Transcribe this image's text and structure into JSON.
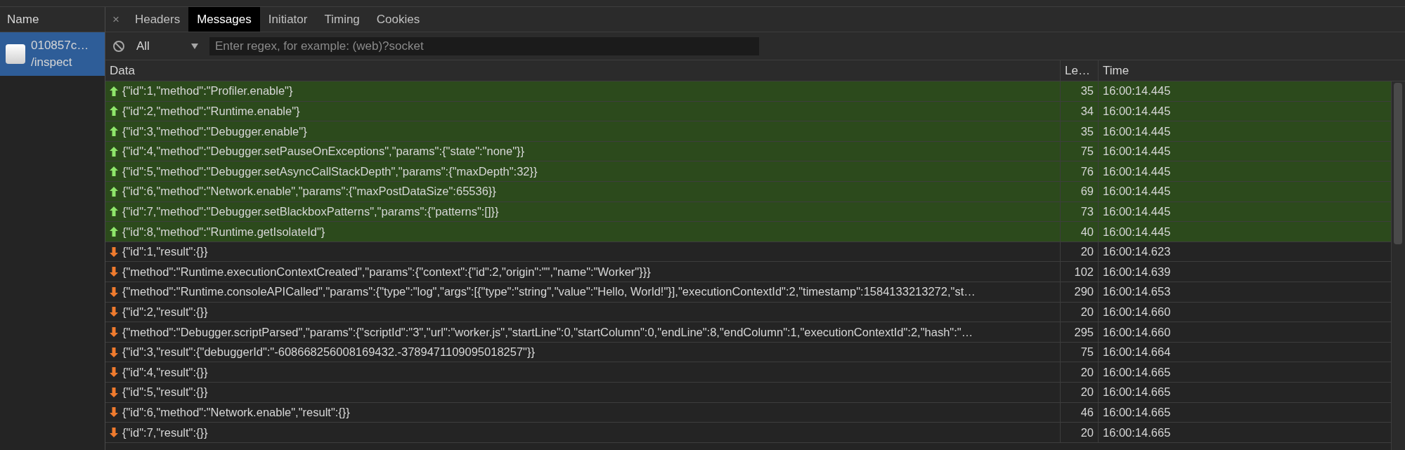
{
  "sidebar": {
    "header": "Name",
    "items": [
      {
        "name": "010857c…",
        "path": "/inspect",
        "selected": true
      }
    ]
  },
  "tabs_bar": {
    "close": "×",
    "tabs": [
      {
        "label": "Headers",
        "selected": false
      },
      {
        "label": "Messages",
        "selected": true
      },
      {
        "label": "Initiator",
        "selected": false
      },
      {
        "label": "Timing",
        "selected": false
      },
      {
        "label": "Cookies",
        "selected": false
      }
    ]
  },
  "filter": {
    "dropdown": "All",
    "placeholder": "Enter regex, for example: (web)?socket"
  },
  "table": {
    "columns": [
      "Data",
      "Le…",
      "Time"
    ],
    "rows": [
      {
        "kind": "sent",
        "data": "{\"id\":1,\"method\":\"Profiler.enable\"}",
        "length": "35",
        "time": "16:00:14.445"
      },
      {
        "kind": "sent",
        "data": "{\"id\":2,\"method\":\"Runtime.enable\"}",
        "length": "34",
        "time": "16:00:14.445"
      },
      {
        "kind": "sent",
        "data": "{\"id\":3,\"method\":\"Debugger.enable\"}",
        "length": "35",
        "time": "16:00:14.445"
      },
      {
        "kind": "sent",
        "data": "{\"id\":4,\"method\":\"Debugger.setPauseOnExceptions\",\"params\":{\"state\":\"none\"}}",
        "length": "75",
        "time": "16:00:14.445"
      },
      {
        "kind": "sent",
        "data": "{\"id\":5,\"method\":\"Debugger.setAsyncCallStackDepth\",\"params\":{\"maxDepth\":32}}",
        "length": "76",
        "time": "16:00:14.445"
      },
      {
        "kind": "sent",
        "data": "{\"id\":6,\"method\":\"Network.enable\",\"params\":{\"maxPostDataSize\":65536}}",
        "length": "69",
        "time": "16:00:14.445"
      },
      {
        "kind": "sent",
        "data": "{\"id\":7,\"method\":\"Debugger.setBlackboxPatterns\",\"params\":{\"patterns\":[]}}",
        "length": "73",
        "time": "16:00:14.445"
      },
      {
        "kind": "sent",
        "data": "{\"id\":8,\"method\":\"Runtime.getIsolateId\"}",
        "length": "40",
        "time": "16:00:14.445"
      },
      {
        "kind": "received",
        "data": "{\"id\":1,\"result\":{}}",
        "length": "20",
        "time": "16:00:14.623"
      },
      {
        "kind": "received",
        "data": "{\"method\":\"Runtime.executionContextCreated\",\"params\":{\"context\":{\"id\":2,\"origin\":\"\",\"name\":\"Worker\"}}}",
        "length": "102",
        "time": "16:00:14.639"
      },
      {
        "kind": "received",
        "data": "{\"method\":\"Runtime.consoleAPICalled\",\"params\":{\"type\":\"log\",\"args\":[{\"type\":\"string\",\"value\":\"Hello, World!\"}],\"executionContextId\":2,\"timestamp\":1584133213272,\"st…",
        "length": "290",
        "time": "16:00:14.653"
      },
      {
        "kind": "received",
        "data": "{\"id\":2,\"result\":{}}",
        "length": "20",
        "time": "16:00:14.660"
      },
      {
        "kind": "received",
        "data": "{\"method\":\"Debugger.scriptParsed\",\"params\":{\"scriptId\":\"3\",\"url\":\"worker.js\",\"startLine\":0,\"startColumn\":0,\"endLine\":8,\"endColumn\":1,\"executionContextId\":2,\"hash\":\"…",
        "length": "295",
        "time": "16:00:14.660"
      },
      {
        "kind": "received",
        "data": "{\"id\":3,\"result\":{\"debuggerId\":\"-608668256008169432.-3789471109095018257\"}}",
        "length": "75",
        "time": "16:00:14.664"
      },
      {
        "kind": "received",
        "data": "{\"id\":4,\"result\":{}}",
        "length": "20",
        "time": "16:00:14.665"
      },
      {
        "kind": "received",
        "data": "{\"id\":5,\"result\":{}}",
        "length": "20",
        "time": "16:00:14.665"
      },
      {
        "kind": "received",
        "data": "{\"id\":6,\"method\":\"Network.enable\",\"result\":{}}",
        "length": "46",
        "time": "16:00:14.665"
      },
      {
        "kind": "received",
        "data": "{\"id\":7,\"result\":{}}",
        "length": "20",
        "time": "16:00:14.665"
      }
    ]
  }
}
